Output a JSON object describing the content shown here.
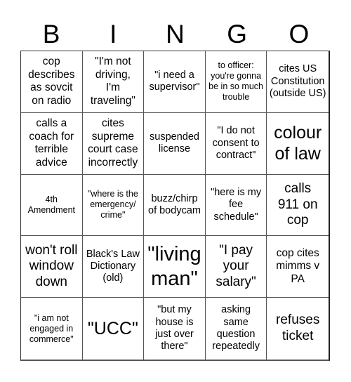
{
  "title_letters": [
    "B",
    "I",
    "N",
    "G",
    "O"
  ],
  "cells": [
    {
      "text": "cop describes as sovcit on radio"
    },
    {
      "text": "\"I'm not driving, I'm traveling\""
    },
    {
      "text": "\"i need a supervisor\""
    },
    {
      "text": "to officer: you're gonna be in so much trouble"
    },
    {
      "text": "cites US Constitution (outside US)"
    },
    {
      "text": "calls a coach for terrible advice"
    },
    {
      "text": "cites supreme court case incorrectly"
    },
    {
      "text": "suspended license"
    },
    {
      "text": "\"I do not consent to contract\""
    },
    {
      "text": "colour of law"
    },
    {
      "text": "4th Amendment"
    },
    {
      "text": "\"where is the emergency/ crime\""
    },
    {
      "text": "buzz/chirp of bodycam"
    },
    {
      "text": "\"here is my fee schedule\""
    },
    {
      "text": "calls 911 on cop"
    },
    {
      "text": "won't roll window down"
    },
    {
      "text": "Black's Law Dictionary (old)"
    },
    {
      "text": "\"living man\""
    },
    {
      "text": "\"I pay your salary\""
    },
    {
      "text": "cop cites mimms v PA"
    },
    {
      "text": "\"i am not engaged in commerce\""
    },
    {
      "text": "\"UCC\""
    },
    {
      "text": "\"but my house is just over there\""
    },
    {
      "text": "asking same question repeatedly"
    },
    {
      "text": "refuses ticket"
    }
  ]
}
